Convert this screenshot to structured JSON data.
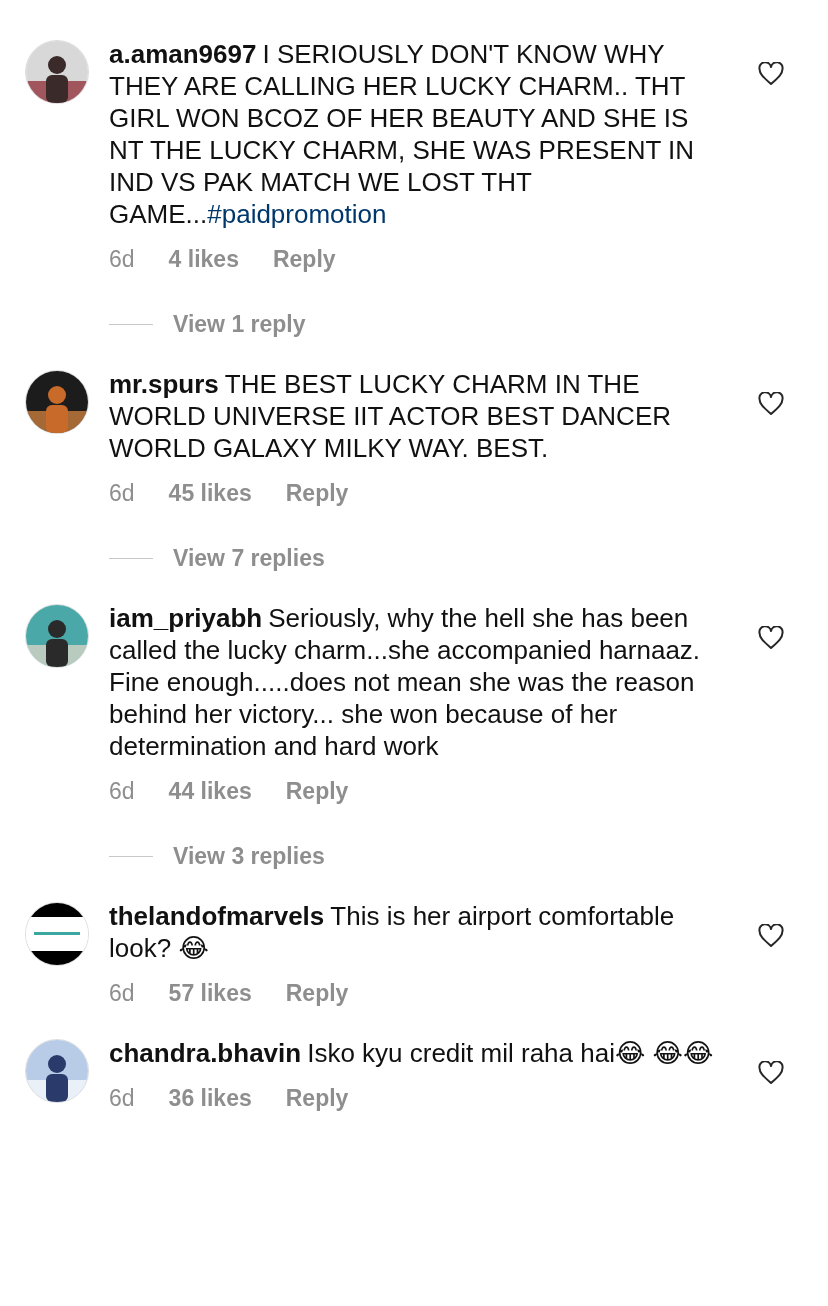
{
  "comments": [
    {
      "username": "a.aman9697",
      "text": "I SERIOUSLY DON'T KNOW WHY THEY ARE CALLING HER LUCKY CHARM.. THT GIRL WON BCOZ OF HER BEAUTY AND SHE IS NT THE LUCKY CHARM, SHE WAS PRESENT IN IND VS PAK MATCH WE LOST THT GAME...",
      "hashtag": "#paidpromotion",
      "time": "6d",
      "likes": "4 likes",
      "reply": "Reply",
      "view_replies": "View 1 reply"
    },
    {
      "username": "mr.spurs",
      "text": "THE BEST LUCKY CHARM IN THE WORLD UNIVERSE IIT ACTOR BEST DANCER WORLD GALAXY MILKY WAY. BEST.",
      "time": "6d",
      "likes": "45 likes",
      "reply": "Reply",
      "view_replies": "View 7 replies"
    },
    {
      "username": "iam_priyabh",
      "text": "Seriously, why the hell she has been called the lucky charm...she accompanied harnaaz. Fine enough.....does not mean she was the reason behind her victory... she won because of her determination and hard work",
      "time": "6d",
      "likes": "44 likes",
      "reply": "Reply",
      "view_replies": "View 3 replies"
    },
    {
      "username": "thelandofmarvels",
      "text": "This is her airport comfortable look? 😂",
      "time": "6d",
      "likes": "57 likes",
      "reply": "Reply"
    },
    {
      "username": "chandra.bhavin",
      "text": "Isko kyu credit mil raha hai😂 😂😂",
      "time": "6d",
      "likes": "36 likes",
      "reply": "Reply"
    }
  ]
}
